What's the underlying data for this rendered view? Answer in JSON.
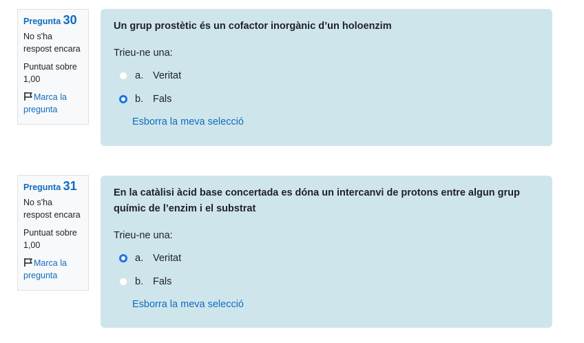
{
  "questions": [
    {
      "label": "Pregunta",
      "number": "30",
      "status": "No s'ha respost encara",
      "score": "Puntuat sobre 1,00",
      "flag_label": "Marca la pregunta",
      "text": "Un grup prostètic és un cofactor inorgànic d’un holoenzim",
      "prompt": "Trieu-ne una:",
      "options": [
        {
          "letter": "a.",
          "text": "Veritat",
          "selected": false
        },
        {
          "letter": "b.",
          "text": "Fals",
          "selected": true
        }
      ],
      "clear_label": "Esborra la meva selecció"
    },
    {
      "label": "Pregunta",
      "number": "31",
      "status": "No s'ha respost encara",
      "score": "Puntuat sobre 1,00",
      "flag_label": "Marca la pregunta",
      "text": "En la catàlisi àcid base concertada es dóna un intercanvi de protons entre algun grup químic de l’enzim i el substrat",
      "prompt": "Trieu-ne una:",
      "options": [
        {
          "letter": "a.",
          "text": "Veritat",
          "selected": true
        },
        {
          "letter": "b.",
          "text": "Fals",
          "selected": false
        }
      ],
      "clear_label": "Esborra la meva selecció"
    }
  ],
  "colors": {
    "accent": "#0f6cbf",
    "radio_selected": "#1a73e8",
    "content_bg": "#cfe5ec",
    "info_bg": "#f8f9fa"
  }
}
